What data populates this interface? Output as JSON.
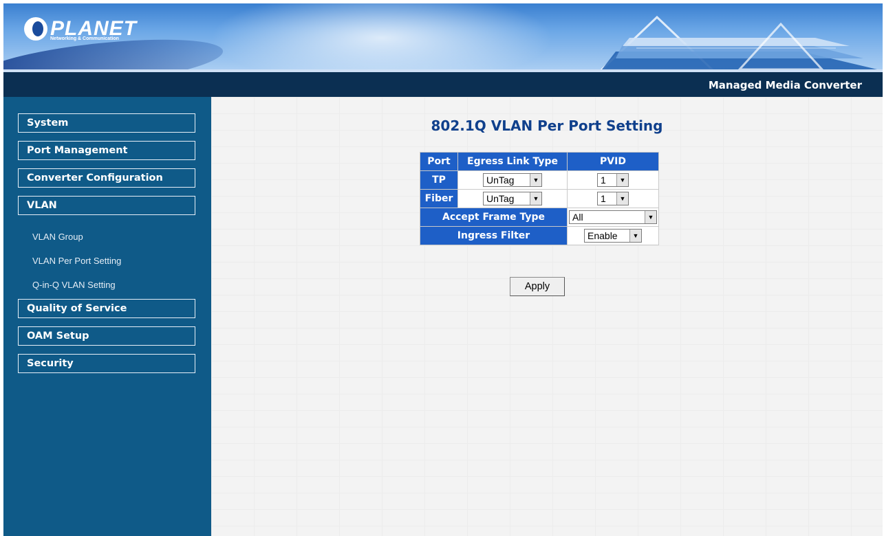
{
  "header": {
    "brand": "PLANET",
    "brand_sub": "Networking & Communication",
    "product": "Managed Media Converter"
  },
  "sidebar": {
    "items": [
      {
        "label": "System"
      },
      {
        "label": "Port Management"
      },
      {
        "label": "Converter Configuration"
      },
      {
        "label": "VLAN"
      },
      {
        "label": "Quality of Service"
      },
      {
        "label": "OAM Setup"
      },
      {
        "label": "Security"
      }
    ],
    "vlan_sub": [
      {
        "label": "VLAN Group"
      },
      {
        "label": "VLAN Per Port Setting"
      },
      {
        "label": "Q-in-Q VLAN Setting"
      }
    ]
  },
  "main": {
    "title": "802.1Q VLAN Per Port Setting",
    "table": {
      "headers": {
        "port": "Port",
        "egress": "Egress Link Type",
        "pvid": "PVID"
      },
      "rows": [
        {
          "port": "TP",
          "egress": "UnTag",
          "pvid": "1"
        },
        {
          "port": "Fiber",
          "egress": "UnTag",
          "pvid": "1"
        }
      ],
      "accept_label": "Accept Frame Type",
      "accept_value": "All",
      "ingress_label": "Ingress Filter",
      "ingress_value": "Enable"
    },
    "apply_label": "Apply"
  },
  "colors": {
    "header_bar": "#0b2f52",
    "sidebar": "#0f5a88",
    "table_header": "#1e5fc7",
    "title": "#10408c"
  }
}
